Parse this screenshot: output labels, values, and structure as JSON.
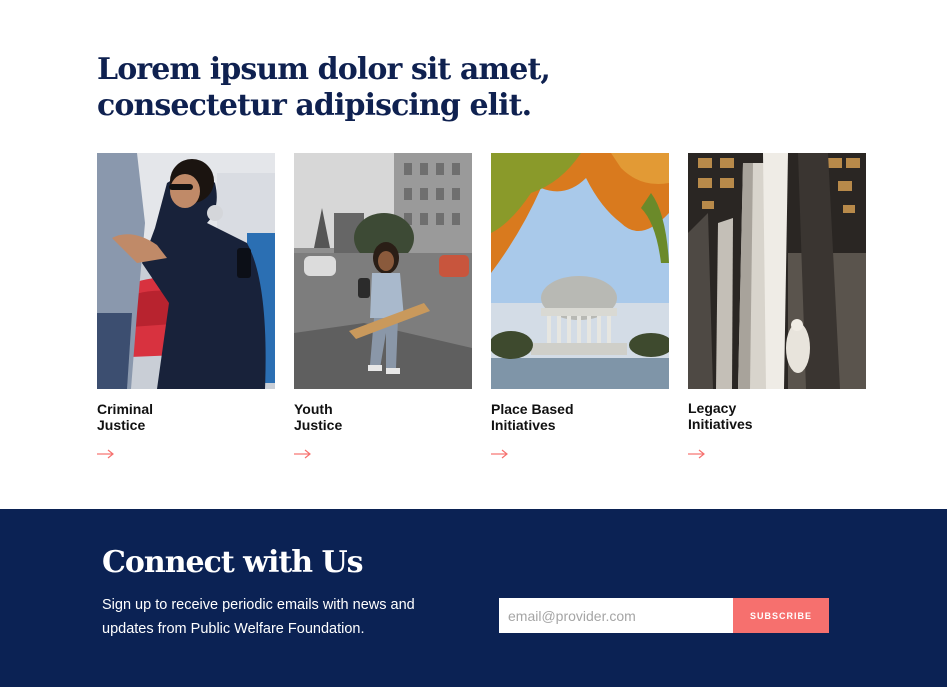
{
  "headline": {
    "line1": "Lorem ipsum dolor sit amet,",
    "line2": "consectetur adipiscing elit."
  },
  "cards": [
    {
      "line1": "Criminal",
      "line2": "Justice",
      "icon": "arrow-right-icon"
    },
    {
      "line1": "Youth",
      "line2": "Justice",
      "icon": "arrow-right-icon"
    },
    {
      "line1": "Place Based",
      "line2": "Initiatives",
      "icon": "arrow-right-icon"
    },
    {
      "line1": "Legacy",
      "line2": "Initiatives",
      "icon": "arrow-right-icon"
    }
  ],
  "connect": {
    "title": "Connect with Us",
    "description": "Sign up to receive periodic emails with news and updates from Public Welfare Foundation.",
    "email_placeholder": "email@provider.com",
    "email_value": "",
    "subscribe_label": "SUBSCRIBE"
  },
  "colors": {
    "navy": "#0b2254",
    "heading": "#0f2150",
    "accent": "#f6706e"
  }
}
